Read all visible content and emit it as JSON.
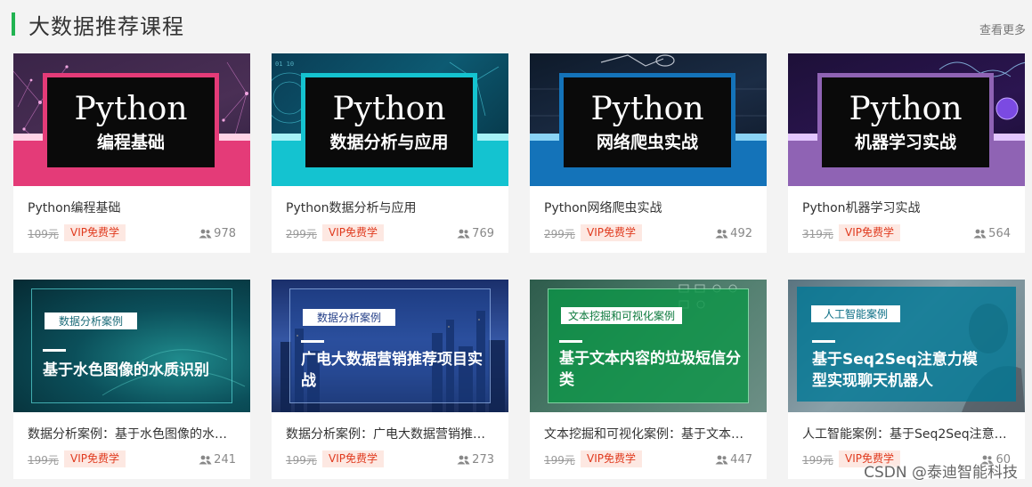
{
  "header": {
    "title": "大数据推荐课程",
    "more_label": "查看更多",
    "accent_color": "#21b351"
  },
  "courses": [
    {
      "thumb_title": "Python",
      "thumb_subtitle": "编程基础",
      "title": "Python编程基础",
      "price": "109元",
      "vip_label": "VIP免费学",
      "students": "978"
    },
    {
      "thumb_title": "Python",
      "thumb_subtitle": "数据分析与应用",
      "title": "Python数据分析与应用",
      "price": "299元",
      "vip_label": "VIP免费学",
      "students": "769"
    },
    {
      "thumb_title": "Python",
      "thumb_subtitle": "网络爬虫实战",
      "title": "Python网络爬虫实战",
      "price": "299元",
      "vip_label": "VIP免费学",
      "students": "492"
    },
    {
      "thumb_title": "Python",
      "thumb_subtitle": "机器学习实战",
      "title": "Python机器学习实战",
      "price": "319元",
      "vip_label": "VIP免费学",
      "students": "564"
    },
    {
      "thumb_tag": "数据分析案例",
      "thumb_heading": "基于水色图像的水质识别",
      "title": "数据分析案例：基于水色图像的水…",
      "price": "199元",
      "vip_label": "VIP免费学",
      "students": "241"
    },
    {
      "thumb_tag": "数据分析案例",
      "thumb_heading": "广电大数据营销推荐项目实战",
      "title": "数据分析案例：广电大数据营销推…",
      "price": "199元",
      "vip_label": "VIP免费学",
      "students": "273"
    },
    {
      "thumb_tag": "文本挖掘和可视化案例",
      "thumb_heading": "基于文本内容的垃圾短信分类",
      "title": "文本挖掘和可视化案例：基于文本…",
      "price": "199元",
      "vip_label": "VIP免费学",
      "students": "447"
    },
    {
      "thumb_tag": "人工智能案例",
      "thumb_heading": "基于Seq2Seq注意力模型实现聊天机器人",
      "title": "人工智能案例：基于Seq2Seq注意…",
      "price": "199元",
      "vip_label": "VIP免费学",
      "students": "60"
    }
  ],
  "watermark": "CSDN @泰迪智能科技",
  "colors": {
    "vip_bg": "#fde8e2",
    "vip_text": "#e03a1e",
    "pink_band": "#e43b78",
    "cyan_band": "#14c3d0",
    "blue_band": "#1473b9",
    "purple_band": "#8f63b4"
  }
}
